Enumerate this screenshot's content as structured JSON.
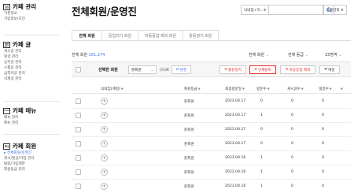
{
  "sidebar": {
    "sections": [
      {
        "title": "카페 관리",
        "icon": "cafe-manage-icon",
        "items": [
          "기본정보",
          "가입정보/조건"
        ]
      },
      {
        "title": "카페 글",
        "icon": "post-icon",
        "items": [
          "게시글 관리",
          "댓글 관리",
          "공지글 관리",
          "스팸글 관리",
          "금칙어글 관리",
          "삭제글 관리"
        ]
      },
      {
        "title": "카페 메뉴",
        "icon": "menu-icon",
        "items": [
          "메뉴 관리",
          "메뉴 관리"
        ]
      },
      {
        "title": "카페 회원",
        "icon": "member-icon",
        "items": [
          "전체회원/운영진",
          "게시/댓글/가입 관리",
          "탈퇴/가입제한",
          "회원등급 관리"
        ],
        "active_index": 0
      }
    ]
  },
  "header": {
    "title": "전체회원/운영진",
    "search_select": "닉네임+이...",
    "search_placeholder": "",
    "detail_search": "상세검색"
  },
  "tabs": [
    "전체 회원",
    "등업대기 회원",
    "자동등업 제외 회원",
    "활동정지 회원"
  ],
  "active_tab": 0,
  "count_label": "전체 회원",
  "count_value": "101,274",
  "filters": {
    "member": "전체 회원",
    "grade": "전체 등급",
    "per_page": "15명씩"
  },
  "action_bar": {
    "selected_label": "선택한 회원",
    "grade_select": "준회원",
    "suffix": "(으)로",
    "change": "변경",
    "suspend": "활동정지",
    "force_withdraw": "강제탈퇴",
    "auto_exclude": "자동등업 제외",
    "mail": "메일"
  },
  "table": {
    "columns": [
      "닉네임(계정)",
      "회원등급",
      "최종방문일",
      "방문수",
      "게시글수",
      "댓글수"
    ],
    "rows": [
      {
        "grade": "준회원",
        "last_visit": "2023.04.17",
        "visits": "0",
        "posts": "0",
        "comments": "0"
      },
      {
        "grade": "준회원",
        "last_visit": "2023.04.17",
        "visits": "1",
        "posts": "0",
        "comments": "0"
      },
      {
        "grade": "준회원",
        "last_visit": "2023.04.17",
        "visits": "0",
        "posts": "0",
        "comments": "0"
      },
      {
        "grade": "준회원",
        "last_visit": "2023.04.17",
        "visits": "0",
        "posts": "0",
        "comments": "0"
      },
      {
        "grade": "준회원",
        "last_visit": "2023.04.16",
        "visits": "1",
        "posts": "0",
        "comments": "0"
      },
      {
        "grade": "준회원",
        "last_visit": "2023.04.16",
        "visits": "1",
        "posts": "0",
        "comments": "0"
      },
      {
        "grade": "준회원",
        "last_visit": "2023.04.16",
        "visits": "1",
        "posts": "0",
        "comments": "0"
      }
    ]
  },
  "colors": {
    "accent": "#3b6ee8",
    "danger": "#dd3333"
  }
}
